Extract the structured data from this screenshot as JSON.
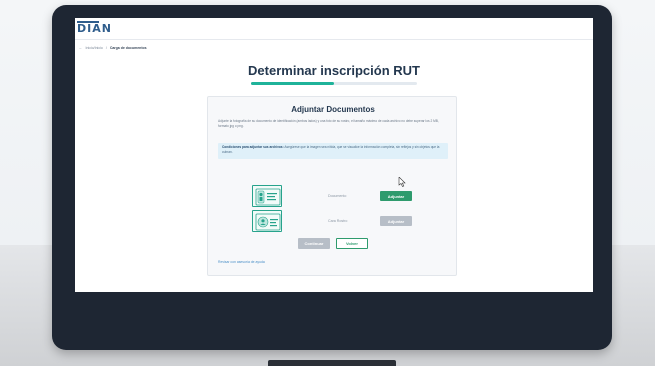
{
  "header": {
    "logo": "DIAN"
  },
  "breadcrumb": {
    "home": "Inicio/Inicio",
    "separator": "/",
    "current": "Carga de documentos"
  },
  "page": {
    "title": "Determinar inscripción RUT",
    "progress": 0.5
  },
  "card": {
    "title": "Adjuntar Documentos",
    "description": "Adjunte la fotografía de su documento de identificación (ambos lados) y una foto de su rostro, el tamaño máximo de cada archivo no debe superar los 2 MB, formato jpg o png.",
    "notice_strong": "Condiciones para adjuntar sus archivos:",
    "notice_text": "Asegúrese que la imagen sea nítida, que se visualice la información completa, sin reflejos y sin objetos que la cubran.",
    "documents": [
      {
        "label": "Documento",
        "button": "Adjuntar",
        "state": "active",
        "icon": "id-card-icon"
      },
      {
        "label": "Cara Rostro",
        "button": "Adjuntar",
        "state": "disabled",
        "icon": "face-id-icon"
      }
    ],
    "continue_label": "Continuar",
    "back_label": "Volver",
    "help_link": "Revisar con asesoría de ayuda"
  },
  "colors": {
    "accent": "#1fb39a",
    "button_active": "#2e9b6d",
    "button_disabled": "#b7bec7",
    "title": "#24384f"
  }
}
